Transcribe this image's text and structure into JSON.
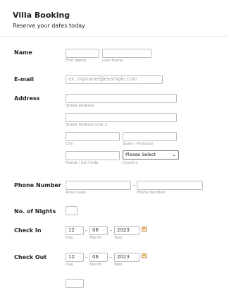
{
  "form": {
    "title": "Villa Booking",
    "subtitle": "Reserve your dates today"
  },
  "name": {
    "label": "Name",
    "first_sub": "First Name",
    "last_sub": "Last Name"
  },
  "email": {
    "label": "E-mail",
    "placeholder": "ex: myname@example.com"
  },
  "address": {
    "label": "Address",
    "street_sub": "Street Address",
    "street2_sub": "Street Address Line 2",
    "city_sub": "City",
    "state_sub": "State / Province",
    "postal_sub": "Postal / Zip Code",
    "country_sub": "Country",
    "country_value": "Please Select"
  },
  "phone": {
    "label": "Phone Number",
    "dash": "-",
    "area_sub": "Area Code",
    "number_sub": "Phone Number"
  },
  "nights": {
    "label": "No. of Nights"
  },
  "check_in": {
    "label": "Check In",
    "day": "12",
    "month": "06",
    "year": "2023",
    "day_sub": "Day",
    "month_sub": "Month",
    "year_sub": "Year",
    "sep": "-",
    "calendar_icon": "calendar-icon"
  },
  "check_out": {
    "label": "Check Out",
    "day": "12",
    "month": "06",
    "year": "2023",
    "day_sub": "Day",
    "month_sub": "Month",
    "year_sub": "Year",
    "sep": "-",
    "calendar_icon": "calendar-icon"
  },
  "colors": {
    "border": "#b8bcc4",
    "sublabel": "#8f949c",
    "text": "#1f1f1f"
  }
}
